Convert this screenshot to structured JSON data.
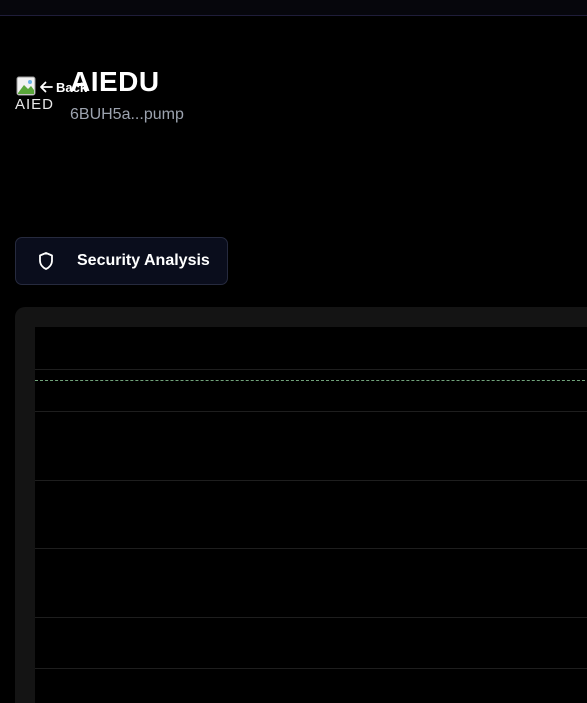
{
  "token": {
    "name": "AIEDU",
    "address": "6BUH5a...pump",
    "logo_alt": "AIEDU"
  },
  "header": {
    "back_label": "Back"
  },
  "actions": {
    "security_label": "Security Analysis"
  },
  "icons": {
    "back": "arrow-left-icon",
    "security": "shield-icon",
    "logo": "broken-image-icon"
  },
  "colors": {
    "background": "#000000",
    "panel": "#141414",
    "button_bg": "#0a0d1c",
    "button_border": "#262a3e",
    "muted_text": "#9ca3af",
    "price_line": "#8fcf9b"
  }
}
